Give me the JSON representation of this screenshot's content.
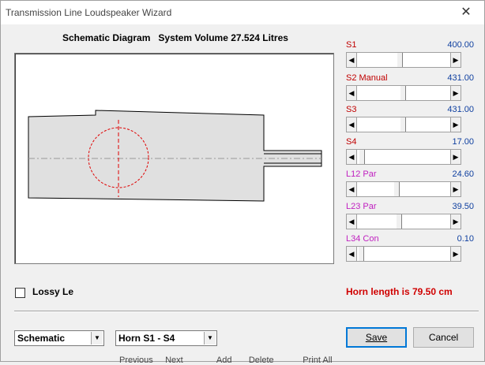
{
  "window": {
    "title": "Transmission Line Loudspeaker Wizard"
  },
  "heading": {
    "label": "Schematic Diagram",
    "volume": "System Volume 27.524 Litres"
  },
  "sliders": [
    {
      "label": "S1",
      "value": "400.00",
      "color": "#c00000",
      "thumb_fraction": 0.45
    },
    {
      "label": "S2  Manual",
      "value": "431.00",
      "color": "#c00000",
      "thumb_fraction": 0.48
    },
    {
      "label": "S3",
      "value": "431.00",
      "color": "#c00000",
      "thumb_fraction": 0.48
    },
    {
      "label": "S4",
      "value": "17.00",
      "color": "#c00000",
      "thumb_fraction": 0.02
    },
    {
      "label": "L12  Par",
      "value": "24.60",
      "color": "#c020c0",
      "thumb_fraction": 0.41
    },
    {
      "label": "L23  Par",
      "value": "39.50",
      "color": "#c020c0",
      "thumb_fraction": 0.44
    },
    {
      "label": "L34  Con",
      "value": "0.10",
      "color": "#c020c0",
      "thumb_fraction": 0.01
    }
  ],
  "lossy": {
    "label": "Lossy Le",
    "checked": false
  },
  "horn_length": "Horn length is 79.50 cm",
  "view_select": {
    "value": "Schematic"
  },
  "horn_select": {
    "value": "Horn S1 - S4"
  },
  "buttons": {
    "save": "Save",
    "cancel": "Cancel"
  },
  "background_text": "Previous     Next              Add       Delete            Print All"
}
